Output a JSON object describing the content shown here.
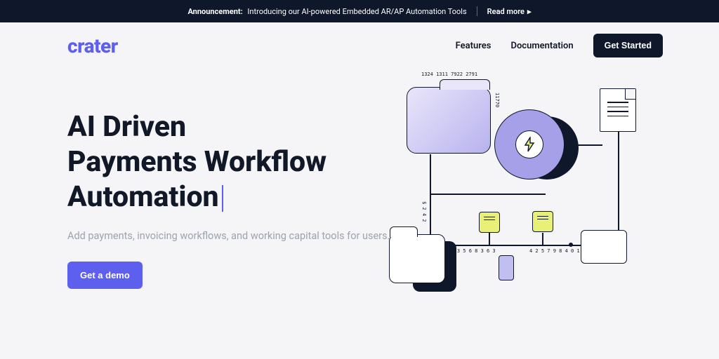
{
  "announcement": {
    "label": "Announcement:",
    "text": "Introducing our AI-powered Embedded AR/AP Automation Tools",
    "read_more": "Read more"
  },
  "nav": {
    "logo": "crater",
    "features": "Features",
    "documentation": "Documentation",
    "get_started": "Get Started"
  },
  "hero": {
    "title_line1": "AI Driven",
    "title_line2": "Payments Workflow",
    "title_line3": "Automation",
    "subtitle": "Add payments, invoicing workflows, and working capital tools for users.",
    "demo_button": "Get a demo"
  },
  "decor": {
    "tt1": "1324 1311 7922 2791",
    "tt2": "11770",
    "tt3": "$ 2 4 2",
    "tt4": "1 4 3 5 6 8 3 6 3",
    "tt5": "4 2 5 7 9 8 4 0 1 9 7 1"
  }
}
